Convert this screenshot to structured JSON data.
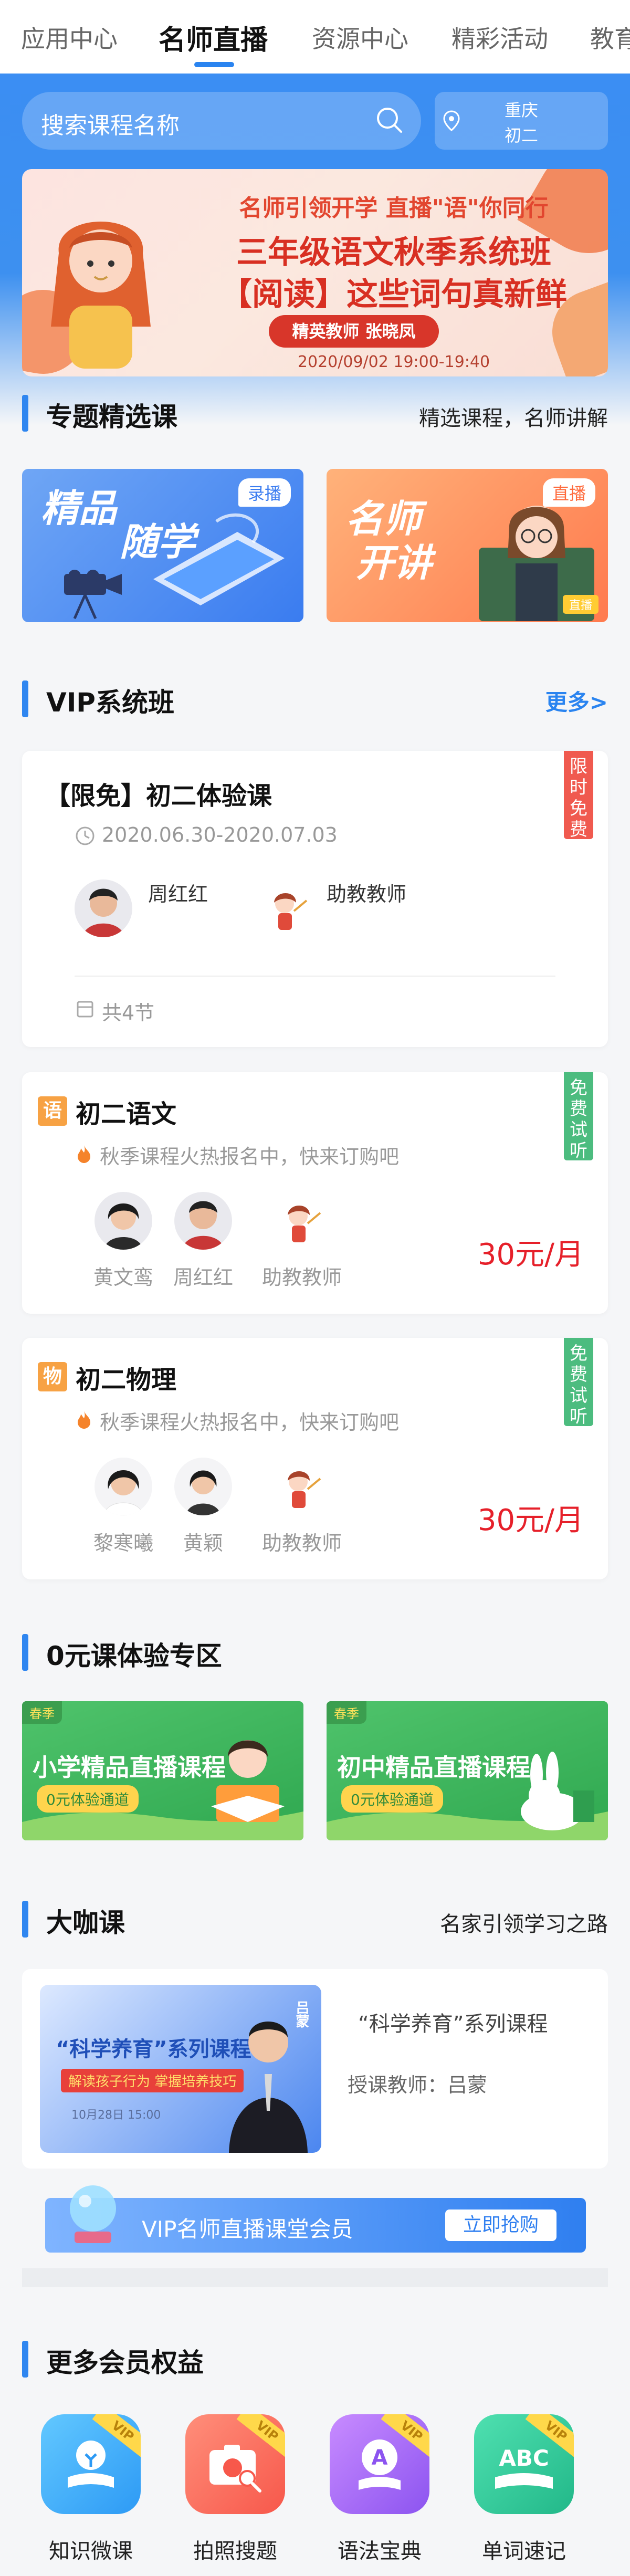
{
  "tabs": [
    {
      "label": "应用中心"
    },
    {
      "label": "名师直播",
      "active": true
    },
    {
      "label": "资源中心"
    },
    {
      "label": "精彩活动"
    },
    {
      "label": "教育"
    }
  ],
  "search": {
    "placeholder": "搜索课程名称"
  },
  "region": {
    "city": "重庆",
    "grade": "初二"
  },
  "banner": {
    "line1": "名师引领开学 直播\"语\"你同行",
    "line2": "三年级语文秋季系统班",
    "line3": "【阅读】这些词句真新鲜",
    "badge": "精英教师 张晓凤",
    "date": "2020/09/02 19:00-19:40"
  },
  "featured": {
    "title": "专题精选课",
    "subtitle": "精选课程，名师讲解",
    "cards": [
      {
        "tag": "录播",
        "title_l1": "精品",
        "title_l2": "随学"
      },
      {
        "tag": "直播",
        "title_l1": "名师",
        "title_l2": "开讲",
        "badge": "直播"
      }
    ]
  },
  "vip": {
    "title": "VIP系统班",
    "more": "更多>",
    "trial": {
      "title": "【限免】初二体验课",
      "date": "2020.06.30-2020.07.03",
      "tag": "限时免费",
      "teachers": [
        {
          "name": "周红红"
        },
        {
          "name": "助教教师"
        }
      ],
      "lessons": "共4节"
    },
    "courses": [
      {
        "badge": "语",
        "title": "初二语文",
        "desc": "秋季课程火热报名中，快来订购吧",
        "tag": "免费试听",
        "price": "30元/月",
        "teachers": [
          {
            "name": "黄文鸾"
          },
          {
            "name": "周红红"
          },
          {
            "name": "助教教师"
          }
        ]
      },
      {
        "badge": "物",
        "title": "初二物理",
        "desc": "秋季课程火热报名中，快来订购吧",
        "tag": "免费试听",
        "price": "30元/月",
        "teachers": [
          {
            "name": "黎寒曦"
          },
          {
            "name": "黄颖"
          },
          {
            "name": "助教教师"
          }
        ]
      }
    ]
  },
  "free_zone": {
    "title": "0元课体验专区",
    "cards": [
      {
        "corner": "春季",
        "title": "小学精品直播课程",
        "button": "0元体验通道"
      },
      {
        "corner": "春季",
        "title": "初中精品直播课程",
        "button": "0元体验通道"
      }
    ]
  },
  "big_name": {
    "title": "大咖课",
    "subtitle": "名家引领学习之路",
    "course_title": "“科学养育”系列课程",
    "teacher": "授课教师：吕蒙",
    "poster_title": "“科学养育”系列课程",
    "poster_sub": "解读孩子行为 掌握培养技巧",
    "poster_name": "吕蒙",
    "poster_date": "10月28日 15:00"
  },
  "vip_member": {
    "text": "VIP名师直播课堂会员",
    "button": "立即抢购"
  },
  "rights": {
    "title": "更多会员权益",
    "items": [
      {
        "label": "知识微课",
        "vip": "VIP"
      },
      {
        "label": "拍照搜题",
        "vip": "VIP"
      },
      {
        "label": "语法宝典",
        "vip": "VIP"
      },
      {
        "label": "单词速记",
        "vip": "VIP"
      }
    ]
  },
  "colors": {
    "primary": "#2f86f0",
    "price": "#e6202a",
    "tag_red": "#f05a4f",
    "tag_green": "#4cbc7f"
  }
}
